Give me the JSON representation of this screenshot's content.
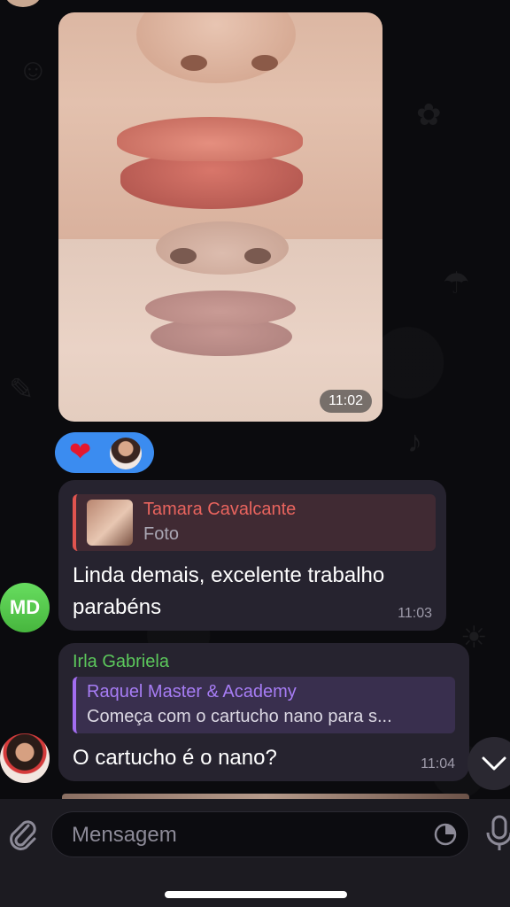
{
  "photo_message": {
    "time": "11:02"
  },
  "reaction": {
    "emoji": "❤"
  },
  "message1": {
    "avatar_initials": "MD",
    "reply_name": "Tamara Cavalcante",
    "reply_text": "Foto",
    "line1": "Linda demais, excelente trabalho",
    "line2": "parabéns",
    "time": "11:03"
  },
  "message2": {
    "sender": "Irla Gabriela",
    "reply_name": "Raquel Master & Academy",
    "reply_text": "Começa com o cartucho nano para s...",
    "text": "O cartucho é o nano?",
    "time": "11:04"
  },
  "input": {
    "placeholder": "Mensagem"
  },
  "colors": {
    "bubble": "#26232f",
    "reply1_accent": "#e0544f",
    "reply2_accent": "#a26df0",
    "sender_green": "#5cc85c",
    "reaction_blue": "#3b8cf0"
  },
  "icons": [
    "attach-icon",
    "sticker-icon",
    "mic-icon",
    "chevron-down-icon",
    "heart-icon"
  ]
}
